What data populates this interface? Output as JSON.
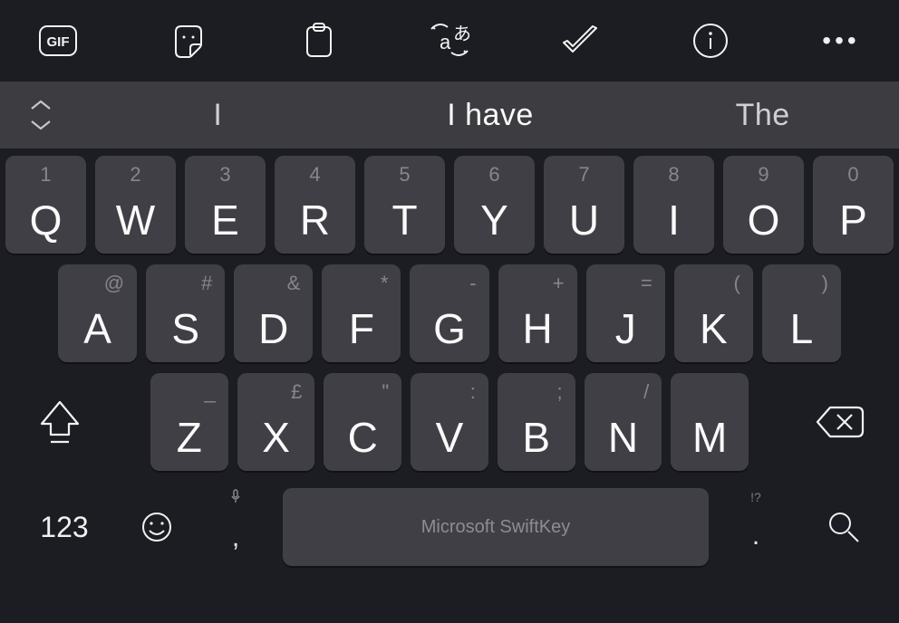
{
  "toolbar": {
    "gif_label": "GIF",
    "more_dots": "•••"
  },
  "suggestions": {
    "items": [
      "I",
      "I have",
      "The"
    ]
  },
  "keys": {
    "row1": [
      {
        "m": "Q",
        "s": "1"
      },
      {
        "m": "W",
        "s": "2"
      },
      {
        "m": "E",
        "s": "3"
      },
      {
        "m": "R",
        "s": "4"
      },
      {
        "m": "T",
        "s": "5"
      },
      {
        "m": "Y",
        "s": "6"
      },
      {
        "m": "U",
        "s": "7"
      },
      {
        "m": "I",
        "s": "8"
      },
      {
        "m": "O",
        "s": "9"
      },
      {
        "m": "P",
        "s": "0"
      }
    ],
    "row2": [
      {
        "m": "A",
        "s": "@"
      },
      {
        "m": "S",
        "s": "#"
      },
      {
        "m": "D",
        "s": "&"
      },
      {
        "m": "F",
        "s": "*"
      },
      {
        "m": "G",
        "s": "-"
      },
      {
        "m": "H",
        "s": "+"
      },
      {
        "m": "J",
        "s": "="
      },
      {
        "m": "K",
        "s": "("
      },
      {
        "m": "L",
        "s": ")"
      }
    ],
    "row3": [
      {
        "m": "Z",
        "s": "_"
      },
      {
        "m": "X",
        "s": "£"
      },
      {
        "m": "C",
        "s": "\""
      },
      {
        "m": "V",
        "s": ":"
      },
      {
        "m": "B",
        "s": ";"
      },
      {
        "m": "N",
        "s": "/"
      },
      {
        "m": "M",
        "s": ""
      }
    ]
  },
  "bottom": {
    "numeric_label": "123",
    "comma": ",",
    "dot": ".",
    "dot_hint": "!?",
    "space_label": "Microsoft SwiftKey"
  }
}
